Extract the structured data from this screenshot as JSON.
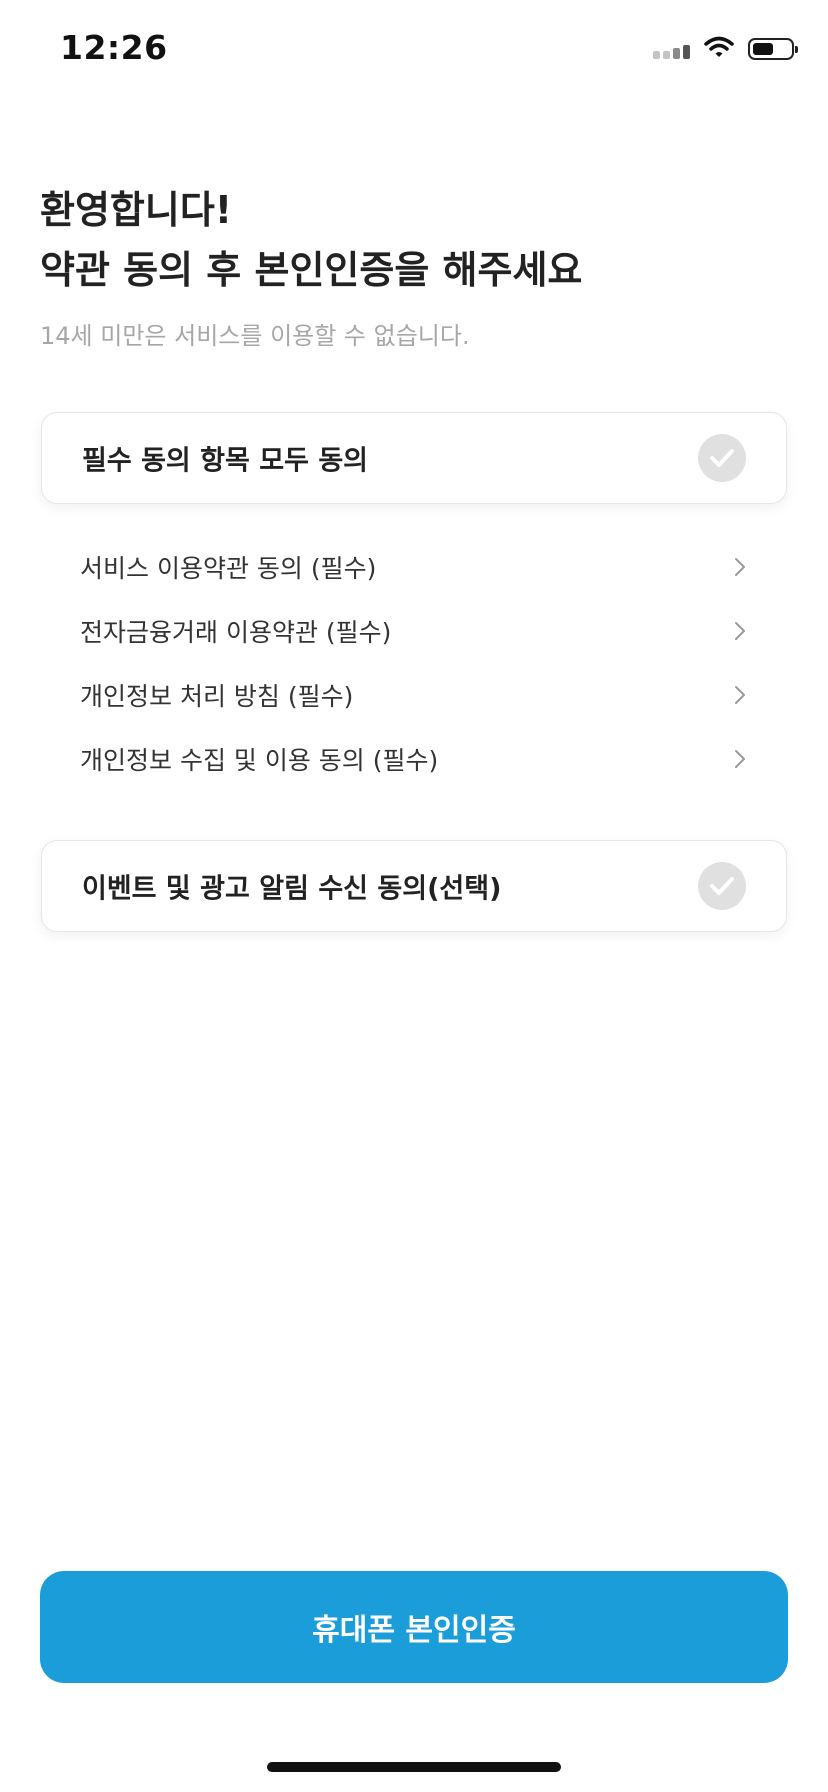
{
  "status_bar": {
    "time": "12:26",
    "icons": [
      "signal-icon",
      "wifi-icon",
      "battery-icon"
    ],
    "battery_level": 0.55
  },
  "header": {
    "title_line1": "환영합니다!",
    "title_line2": "약관 동의 후 본인인증을 해주세요",
    "subtitle": "14세 미만은 서비스를 이용할 수 없습니다."
  },
  "agree_all": {
    "label": "필수 동의 항목 모두 동의",
    "checked": false,
    "icon": "check-icon"
  },
  "terms": [
    {
      "label": "서비스 이용약관 동의 (필수)",
      "icon": "chevron-right-icon"
    },
    {
      "label": "전자금융거래 이용약관 (필수)",
      "icon": "chevron-right-icon"
    },
    {
      "label": "개인정보 처리 방침 (필수)",
      "icon": "chevron-right-icon"
    },
    {
      "label": "개인정보 수집 및 이용 동의 (필수)",
      "icon": "chevron-right-icon"
    }
  ],
  "marketing": {
    "label": "이벤트 및 광고 알림 수신 동의(선택)",
    "checked": false,
    "icon": "check-icon"
  },
  "primary_button": {
    "label": "휴대폰 본인인증"
  },
  "colors": {
    "accent": "#1b9dd9",
    "check_inactive": "#e0e0e0",
    "subtitle": "#a7a7a7"
  }
}
